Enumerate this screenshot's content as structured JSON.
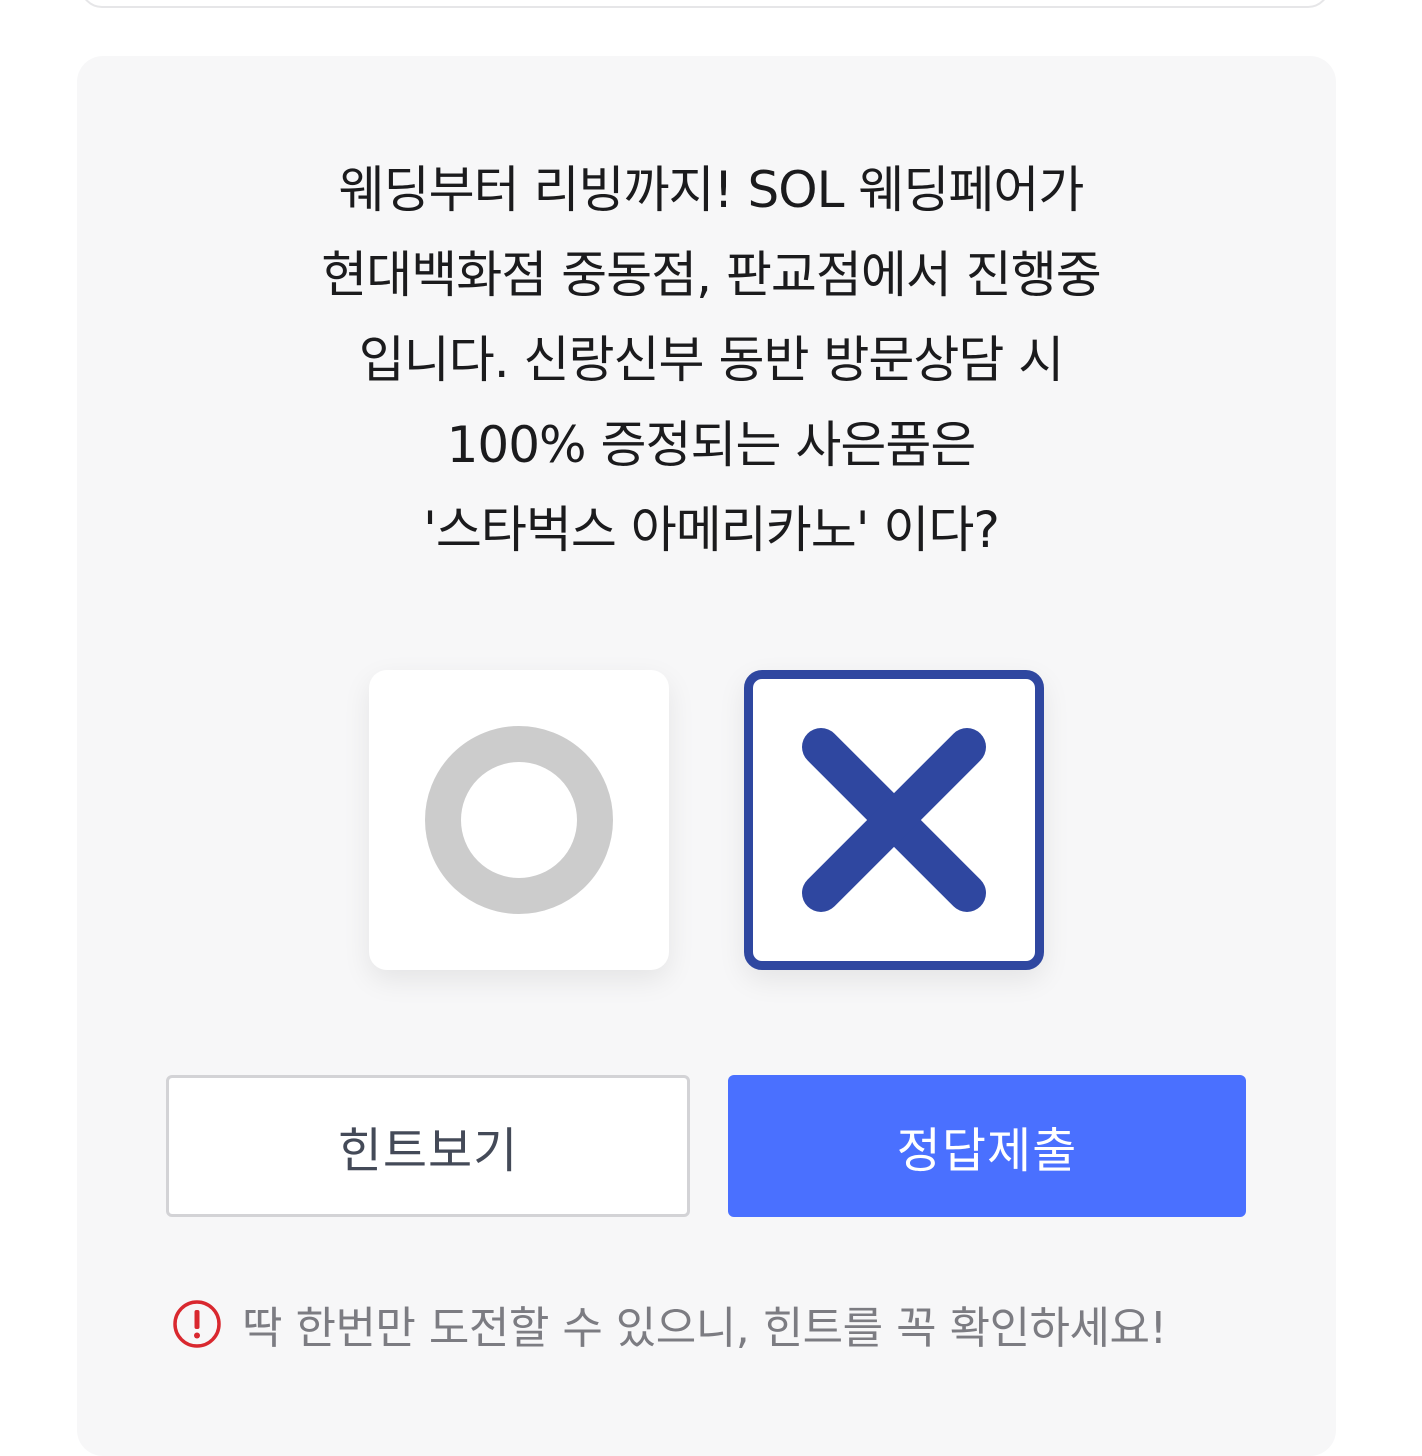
{
  "quiz": {
    "question_lines": [
      "웨딩부터 리빙까지! SOL 웨딩페어가",
      "현대백화점 중동점, 판교점에서 진행중",
      "입니다. 신랑신부 동반 방문상담 시",
      "100% 증정되는 사은품은",
      "'스타벅스 아메리카노' 이다?"
    ],
    "options": [
      {
        "name": "O",
        "selected": false,
        "color": "#cccccc"
      },
      {
        "name": "X",
        "selected": true,
        "color": "#2f47a0"
      }
    ]
  },
  "buttons": {
    "hint_label": "힌트보기",
    "submit_label": "정답제출"
  },
  "notice": {
    "icon": "exclamation-circle-icon",
    "text": "딱 한번만 도전할 수 있으니, 힌트를 꼭 확인하세요!",
    "icon_color": "#d9282f"
  },
  "colors": {
    "accent": "#4a70ff",
    "selected_border": "#2f47a0",
    "card_background": "#f7f7f8"
  }
}
